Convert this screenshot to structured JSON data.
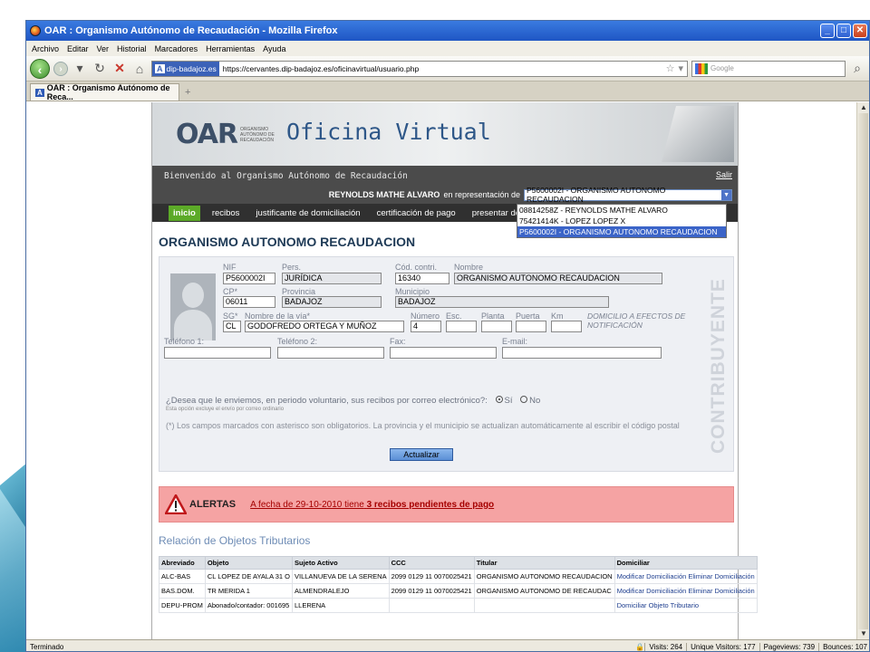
{
  "browser": {
    "title": "OAR : Organismo Autónomo de Recaudación - Mozilla Firefox",
    "menu": [
      "Archivo",
      "Editar",
      "Ver",
      "Historial",
      "Marcadores",
      "Herramientas",
      "Ayuda"
    ],
    "site_badge": "dip-badajoz.es",
    "url": "https://cervantes.dip-badajoz.es/oficinavirtual/usuario.php",
    "search_placeholder": "Google",
    "tab_label": "OAR : Organismo Autónomo de Reca...",
    "status": "Terminado",
    "stats": [
      "Visits: 264",
      "Unique Visitors: 177",
      "Pageviews: 739",
      "Bounces: 107"
    ]
  },
  "header": {
    "oar_logo": "OAR",
    "oar_small": "ORGANISMO AUTÓNOMO DE RECAUDACIÓN",
    "oficina": "Oficina Virtual",
    "welcome": "Bienvenido al Organismo Autónomo de Recaudación",
    "logout": "Salir",
    "user_name": "REYNOLDS MATHE ALVARO",
    "representing": "en representación de",
    "selected_rep": "P5600002I - ORGANISMO AUTONOMO RECAUDACION",
    "rep_options": [
      "08814258Z - REYNOLDS MATHE ALVARO",
      "75421414K - LOPEZ LOPEZ X",
      "P5600002I - ORGANISMO AUTONOMO RECAUDACION"
    ]
  },
  "nav": [
    "inicio",
    "recibos",
    "justificante de domiciliación",
    "certificación de pago",
    "presentar doc"
  ],
  "main": {
    "title": "ORGANISMO AUTONOMO RECAUDACION",
    "vertical_label": "CONTRIBUYENTE",
    "labels": {
      "nif": "NIF",
      "pers": "Pers.",
      "cod": "Cód. contri.",
      "nombre": "Nombre",
      "cp": "CP*",
      "provincia": "Provincia",
      "municipio": "Municipio",
      "sg": "SG*",
      "via": "Nombre de la vía*",
      "numero": "Número",
      "esc": "Esc.",
      "planta": "Planta",
      "puerta": "Puerta",
      "km": "Km",
      "domicilio": "DOMICILIO A EFECTOS DE NOTIFICACIÓN",
      "tel1": "Teléfono 1:",
      "tel2": "Teléfono 2:",
      "fax": "Fax:",
      "email": "E-mail:"
    },
    "values": {
      "nif": "P5600002I",
      "pers": "JURÍDICA",
      "cod": "16340",
      "nombre": "ORGANISMO AUTONOMO RECAUDACION",
      "cp": "06011",
      "provincia": "BADAJOZ",
      "municipio": "BADAJOZ",
      "sg": "CL",
      "via": "GODOFREDO ORTEGA Y MUÑOZ",
      "numero": "4",
      "esc": "",
      "planta": "",
      "puerta": "",
      "km": "",
      "tel1": "",
      "tel2": "",
      "fax": "",
      "email": ""
    },
    "question": "¿Desea que le enviemos, en periodo voluntario, sus recibos por correo electrónico?:",
    "yes": "Sí",
    "no": "No",
    "question_sub": "Esta opción excluye el envío por correo ordinario",
    "note": "(*) Los campos marcados con asterisco son obligatorios. La provincia y el municipio se actualizan automáticamente al escribir el código postal",
    "update_button": "Actualizar"
  },
  "alerts": {
    "label": "ALERTAS",
    "text_prefix": "A fecha de 29-10-2010 tiene",
    "text_bold": "3 recibos pendientes de pago"
  },
  "objects": {
    "title": "Relación de Objetos Tributarios",
    "headers": [
      "Abreviado",
      "Objeto",
      "Sujeto Activo",
      "CCC",
      "Titular",
      "Domiciliar"
    ],
    "rows": [
      [
        "ALC-BAS",
        "CL LOPEZ DE AYALA 31 O",
        "VILLANUEVA DE LA SERENA",
        "2099 0129 11 0070025421",
        "ORGANISMO AUTONOMO RECAUDACION",
        "Modificar Domiciliación Eliminar Domiciliación"
      ],
      [
        "BAS.DOM.",
        "TR MERIDA 1",
        "ALMENDRALEJO",
        "2099 0129 11 0070025421",
        "ORGANISMO AUTONOMO DE RECAUDAC",
        "Modificar Domiciliación Eliminar Domiciliación"
      ],
      [
        "DEPU-PROM",
        "Abonado/contador: 001695",
        "LLERENA",
        "",
        "",
        "Domiciliar Objeto Tributario"
      ]
    ]
  }
}
